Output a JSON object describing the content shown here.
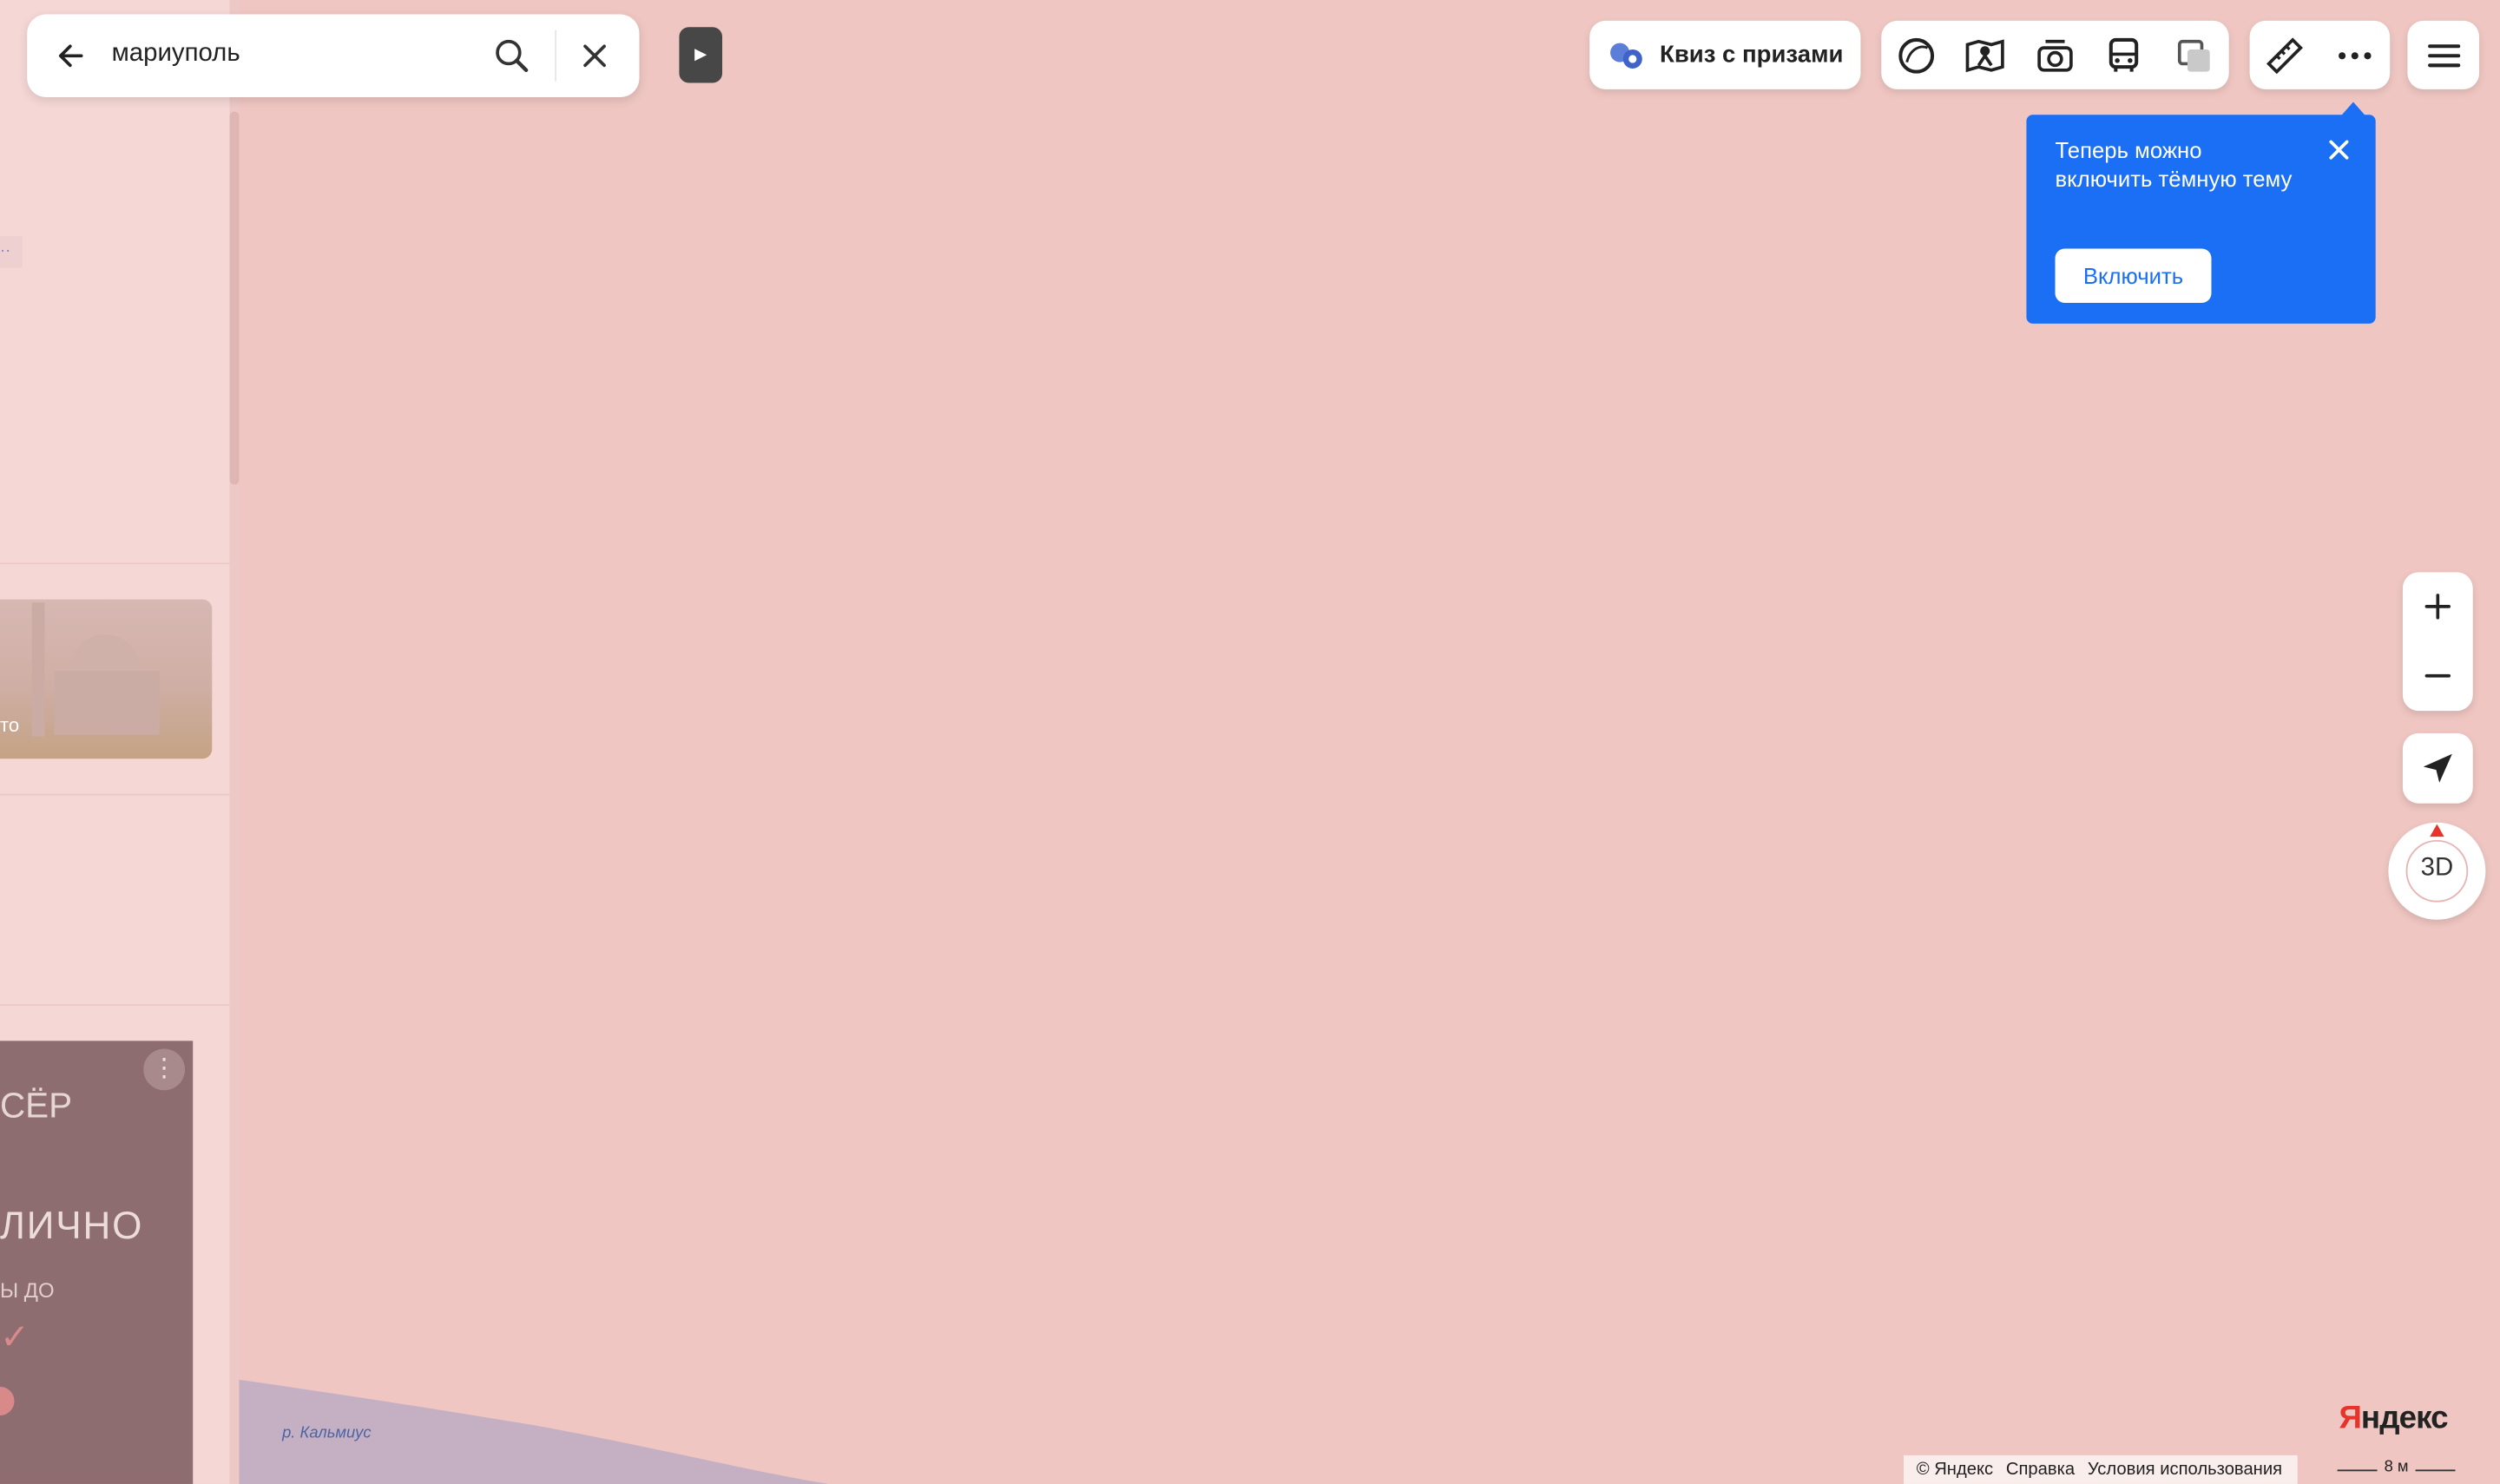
{
  "search": {
    "query": "мариуполь"
  },
  "promo": {
    "label": "Квиз с призами"
  },
  "tooltip": {
    "text": "Теперь можно включить тёмную тему",
    "button": "Включить"
  },
  "map": {
    "river_label": "р. Кальмиус",
    "compass_label": "3D",
    "scale_label": "8 м"
  },
  "panel": {
    "photo_caption": "то",
    "ad": {
      "logo": "СЁР",
      "headline": "ЛИЧНО",
      "subline": "Ы ДО"
    }
  },
  "footer": {
    "brand": "Яндекс",
    "copyright": "© Яндекс",
    "help": "Справка",
    "terms": "Условия использования"
  },
  "colors": {
    "map_bg": "#efc6c2",
    "accent": "#1b6ff4",
    "brand_red": "#e8332a"
  }
}
